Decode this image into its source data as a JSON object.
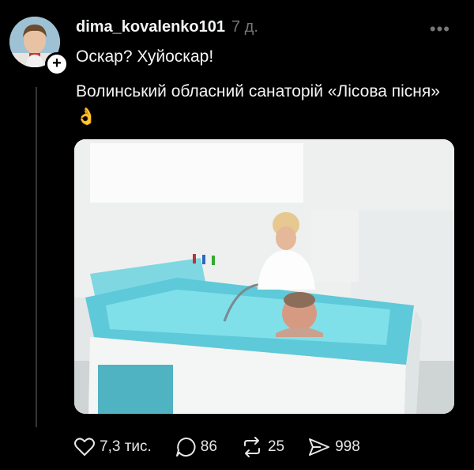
{
  "post": {
    "username": "dima_kovalenko101",
    "time": "7 д.",
    "line1": "Оскар? Хуйоскар!",
    "caption": "Волинський обласний санаторій «Лісова пісня»",
    "emoji": "👌"
  },
  "actions": {
    "likes": "7,3 тис.",
    "comments": "86",
    "reposts": "25",
    "shares": "998"
  },
  "icons": {
    "more": "more-options-icon",
    "like": "heart-icon",
    "comment": "comment-icon",
    "repost": "repost-icon",
    "share": "send-icon"
  },
  "colors": {
    "background": "#000000",
    "text": "#f3f5f7",
    "muted": "#777777",
    "tub": "#5ec9d8"
  }
}
